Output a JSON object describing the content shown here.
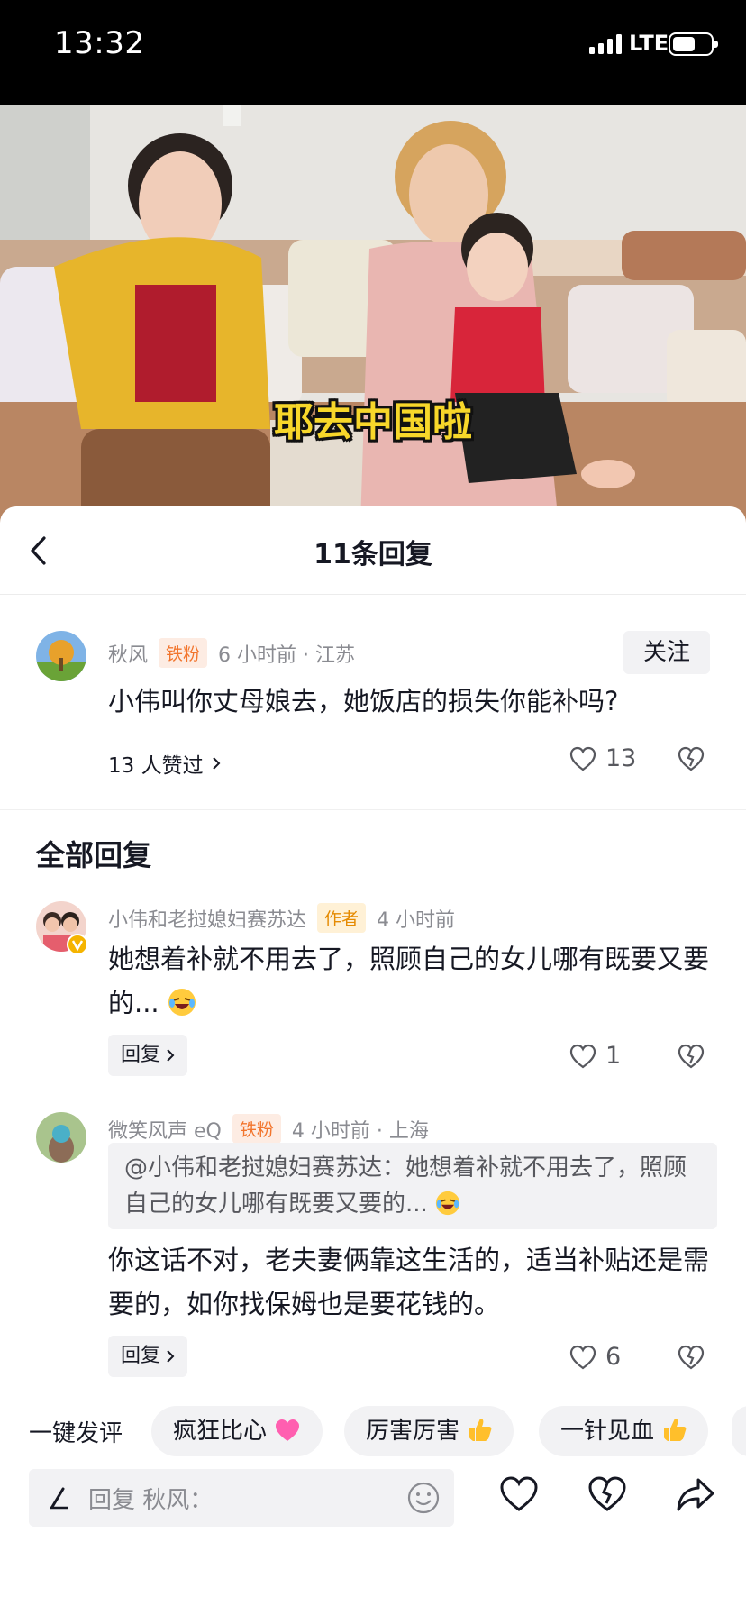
{
  "status": {
    "time": "13:32",
    "network": "LTE"
  },
  "video": {
    "subtitle": "耶去中国啦"
  },
  "header": {
    "title": "11条回复"
  },
  "main_comment": {
    "author": "秋风",
    "tag": "铁粉",
    "time_loc": "6 小时前 · 江苏",
    "follow": "关注",
    "text": "小伟叫你丈母娘去，她饭店的损失你能补吗?",
    "likers": "13 人赞过",
    "like_count": "13"
  },
  "section_title": "全部回复",
  "replies": [
    {
      "author": "小伟和老挝媳妇赛苏达",
      "tag": "作者",
      "time_loc": "4 小时前",
      "text": "她想着补就不用去了，照顾自己的女儿哪有既要又要的...",
      "reply_btn": "回复",
      "like_count": "1"
    },
    {
      "author": "微笑风声 eQ",
      "tag": "铁粉",
      "time_loc": "4 小时前 · 上海",
      "quote": "@小伟和老挝媳妇赛苏达：她想着补就不用去了，照顾自己的女儿哪有既要又要的...",
      "text": "你这话不对，老夫妻俩靠这生活的，适当补贴还是需要的，如你找保姆也是要花钱的。",
      "reply_btn": "回复",
      "like_count": "6"
    }
  ],
  "quick": {
    "label": "一键发评",
    "chips": [
      "疯狂比心",
      "厉害厉害",
      "一针见血"
    ]
  },
  "input": {
    "placeholder": "回复 秋风："
  },
  "icons": {
    "like": "heart-icon",
    "dislike": "broken-heart-icon",
    "share": "share-icon",
    "emoji": "smiley-icon",
    "back": "chevron-left-icon"
  }
}
